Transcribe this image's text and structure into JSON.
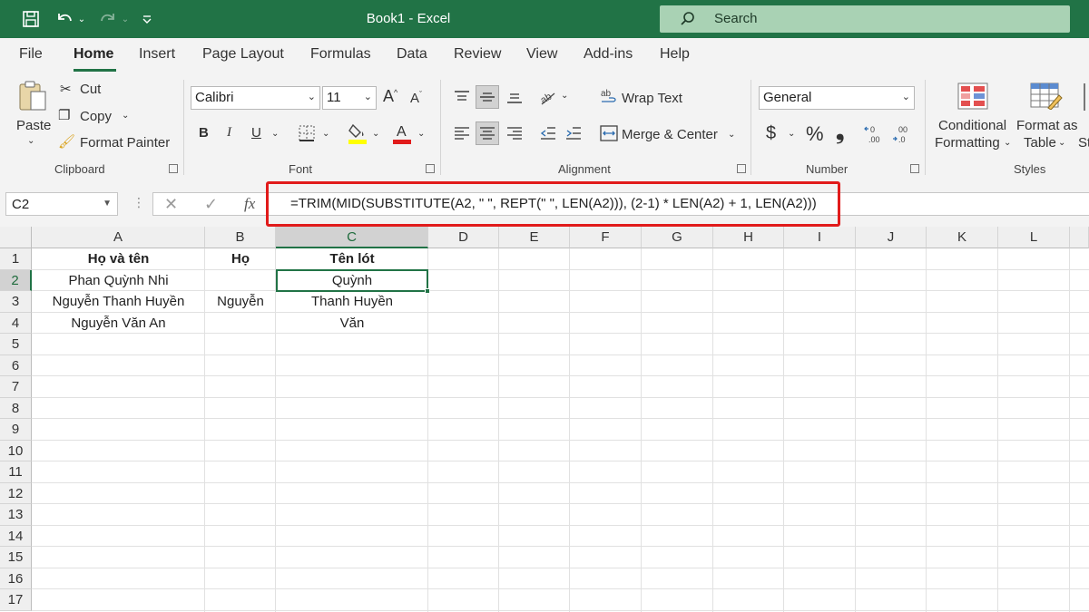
{
  "window": {
    "title": "Book1  -  Excel"
  },
  "search": {
    "label": "Search"
  },
  "menu": {
    "items": [
      "File",
      "Home",
      "Insert",
      "Page Layout",
      "Formulas",
      "Data",
      "Review",
      "View",
      "Add-ins",
      "Help"
    ]
  },
  "ribbon": {
    "clipboard": {
      "paste": "Paste",
      "cut": "Cut",
      "copy": "Copy",
      "format_painter": "Format Painter",
      "label": "Clipboard"
    },
    "font": {
      "name": "Calibri",
      "size": "11",
      "bold": "B",
      "italic": "I",
      "underline": "U",
      "label": "Font",
      "fill_color": "#ffff00",
      "font_color": "#e11b1b"
    },
    "alignment": {
      "wrap": "Wrap Text",
      "merge": "Merge & Center",
      "label": "Alignment"
    },
    "number": {
      "format": "General",
      "currency": "$",
      "percent": "%",
      "comma": "❟",
      "label": "Number"
    },
    "styles": {
      "conditional_line1": "Conditional",
      "conditional_line2": "Formatting",
      "format_table_line1": "Format as",
      "format_table_line2": "Table",
      "label": "Styles",
      "cut_off": "St"
    }
  },
  "formula_bar": {
    "name_box": "C2",
    "fx": "fx",
    "formula": "=TRIM(MID(SUBSTITUTE(A2, \" \", REPT(\" \", LEN(A2))), (2-1) * LEN(A2) + 1, LEN(A2)))"
  },
  "sheet": {
    "columns": [
      "A",
      "B",
      "C",
      "D",
      "E",
      "F",
      "G",
      "H",
      "I",
      "J",
      "K",
      "L"
    ],
    "rows": [
      "1",
      "2",
      "3",
      "4",
      "5",
      "6",
      "7",
      "8",
      "9",
      "10",
      "11",
      "12",
      "13",
      "14",
      "15",
      "16",
      "17"
    ],
    "cells": {
      "A1": "Họ và tên",
      "B1": "Họ",
      "C1": "Tên lót",
      "A2": "Phan Quỳnh Nhi",
      "B2": "",
      "C2": "Quỳnh",
      "A3": "Nguyễn Thanh Huyền",
      "B3": "Nguyễn",
      "C3": "Thanh Huyền",
      "A4": "Nguyễn Văn An",
      "B4": "",
      "C4": "Văn"
    },
    "selected_cell": "C2"
  },
  "colors": {
    "accent": "#217346",
    "highlight": "#e11b1b"
  }
}
